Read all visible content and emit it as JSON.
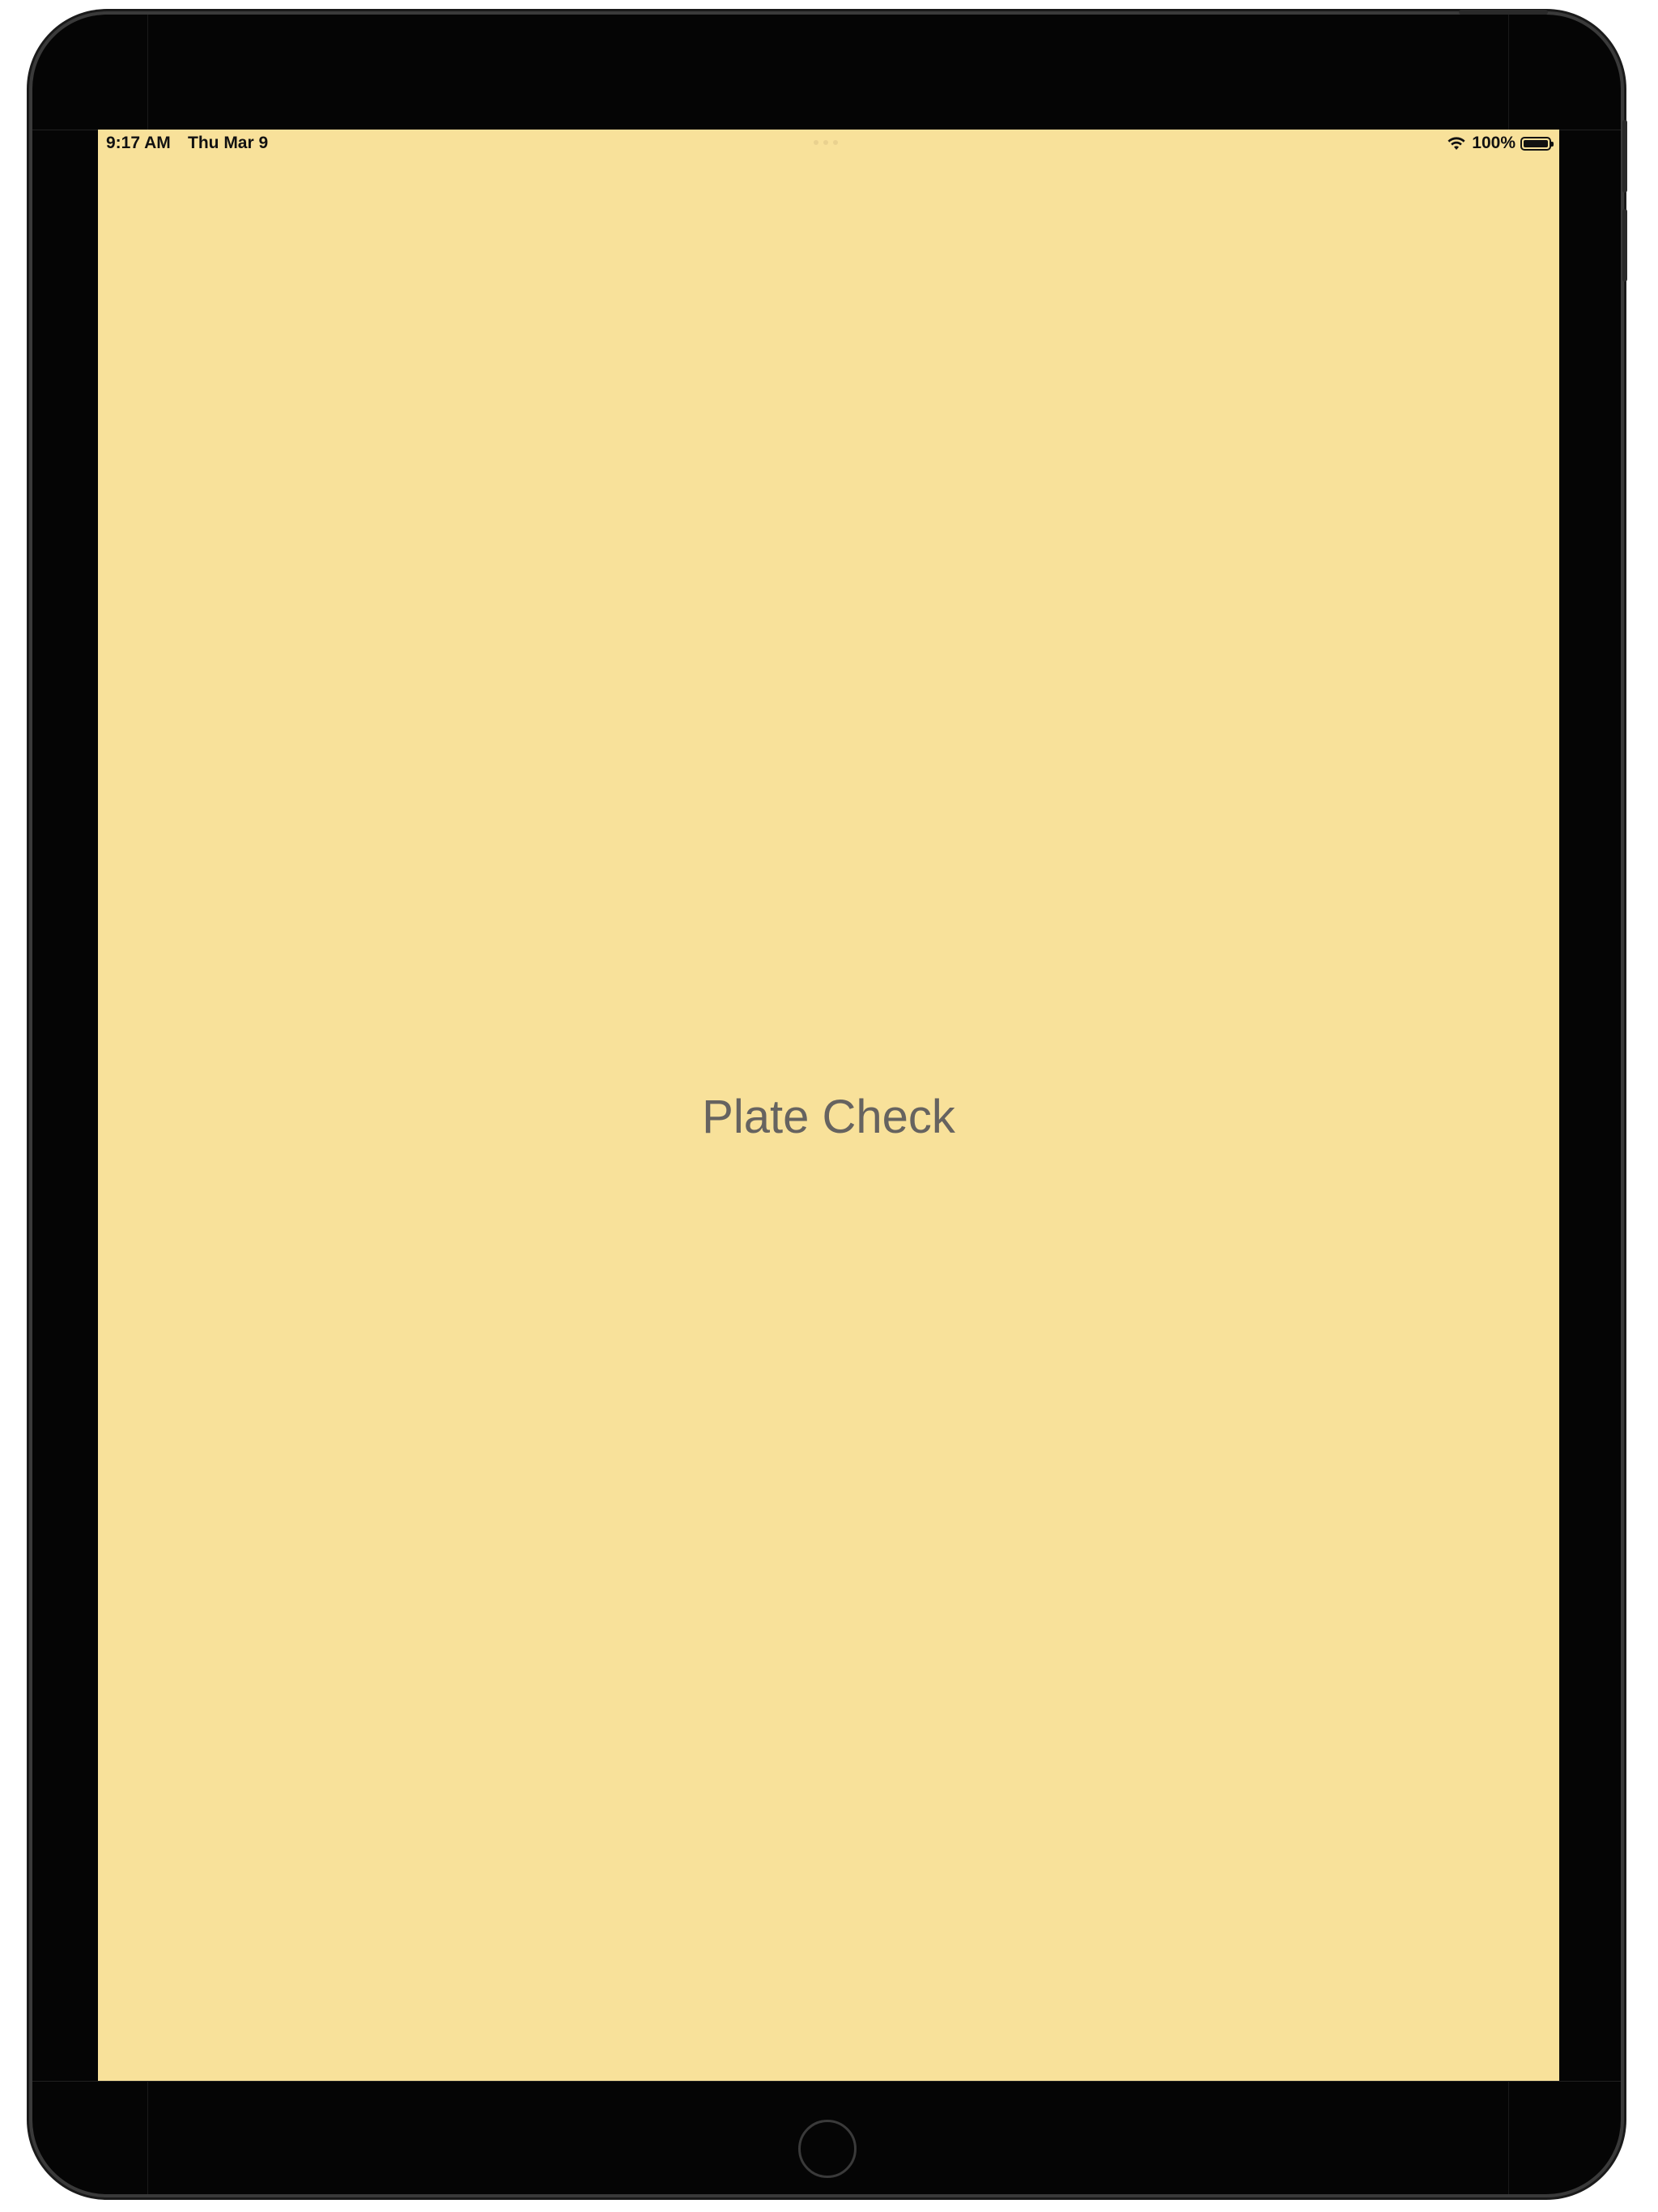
{
  "status_bar": {
    "time": "9:17 AM",
    "date": "Thu Mar 9",
    "battery_percent": "100%",
    "battery_level": 1.0,
    "wifi_icon": "wifi-icon",
    "battery_icon": "battery-icon"
  },
  "main": {
    "title": "Plate Check"
  },
  "colors": {
    "screen_background": "#f8e19a",
    "title_text": "#666360",
    "device_frame": "#050505"
  }
}
